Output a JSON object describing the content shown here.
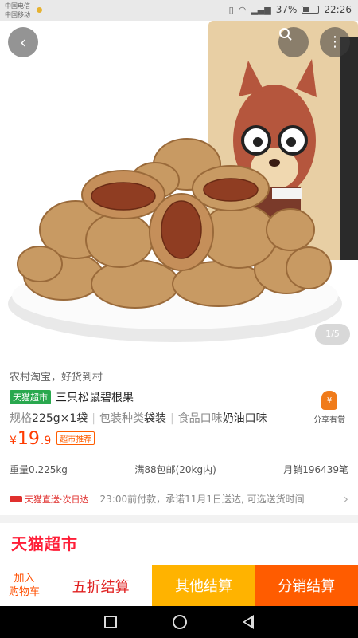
{
  "status_bar": {
    "carrier_1": "中国电信",
    "carrier_2": "中国移动",
    "battery": "37%",
    "time": "22:26"
  },
  "hero": {
    "page_indicator": "1/5",
    "back_icon": "chevron-left-icon",
    "search_icon": "search-icon",
    "more_icon": "more-vertical-icon"
  },
  "product": {
    "slogan": "农村淘宝，好货到村",
    "store_tag": "天猫超市",
    "title": "三只松鼠碧根果",
    "specs": [
      {
        "label": "规格",
        "value": "225g×1袋"
      },
      {
        "label": "包装种类",
        "value": "袋装"
      },
      {
        "label": "食品口味",
        "value": "奶油口味"
      }
    ],
    "share_label": "分享有赏",
    "price_symbol": "¥",
    "price_int": "19",
    "price_dec": ".9",
    "promo_tag": "超市推荐",
    "weight": "重量0.225kg",
    "shipping": "满88包邮(20kg内)",
    "monthly_sales": "月销196439笔",
    "delivery_brand": "天猫直送·次日达",
    "delivery_text": "23:00前付款，承诺11月1日送达, 可选送货时间"
  },
  "store": {
    "name": "天猫超市"
  },
  "bottom_bar": {
    "cart_line1": "加入",
    "cart_line2": "购物车",
    "discount": "五折结算",
    "other": "其他结算",
    "distribution": "分销结算"
  },
  "colors": {
    "price": "#ff3b00",
    "tmall_green": "#29a84e",
    "store_red": "#ff1e38",
    "btn_yellow": "#ffb300",
    "btn_orange": "#ff5c00"
  }
}
